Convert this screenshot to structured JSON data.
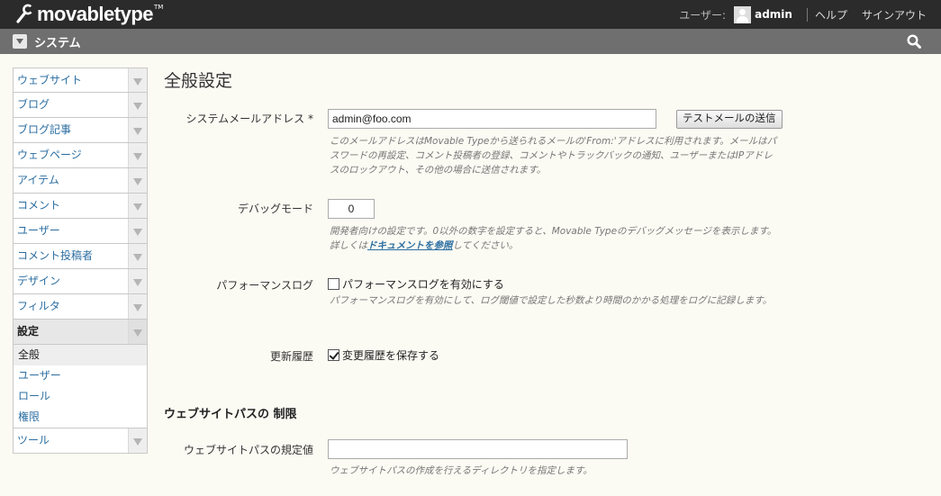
{
  "header": {
    "logo_text": "movabletype",
    "logo_tm": "TM",
    "user_label": "ユーザー:",
    "username": "admin",
    "help": "ヘルプ",
    "signout": "サインアウト"
  },
  "sysbar": {
    "title": "システム"
  },
  "sidebar": {
    "items": [
      {
        "label": "ウェブサイト"
      },
      {
        "label": "ブログ"
      },
      {
        "label": "ブログ記事"
      },
      {
        "label": "ウェブページ"
      },
      {
        "label": "アイテム"
      },
      {
        "label": "コメント"
      },
      {
        "label": "ユーザー"
      },
      {
        "label": "コメント投稿者"
      },
      {
        "label": "デザイン"
      },
      {
        "label": "フィルタ"
      },
      {
        "label": "設定"
      }
    ],
    "submenu": [
      {
        "label": "全般"
      },
      {
        "label": "ユーザー"
      },
      {
        "label": "ロール"
      },
      {
        "label": "権限"
      }
    ],
    "last_item": {
      "label": "ツール"
    }
  },
  "main": {
    "title": "全般設定",
    "email": {
      "label": "システムメールアドレス *",
      "value": "admin@foo.com",
      "button": "テストメールの送信",
      "hint": "このメールアドレスはMovable Typeから送られるメールの'From:'アドレスに利用されます。メールはパスワードの再設定、コメント投稿者の登録、コメントやトラックバックの通知、ユーザーまたはIPアドレスのロックアウト、その他の場合に送信されます。"
    },
    "debug": {
      "label": "デバッグモード",
      "value": "0",
      "hint_before": "開発者向けの設定です。0以外の数字を設定すると、Movable Typeのデバッグメッセージを表示します。詳しくは",
      "hint_link": "ドキュメントを参照",
      "hint_after": "してください。"
    },
    "perflog": {
      "label": "パフォーマンスログ",
      "checkbox_label": "パフォーマンスログを有効にする",
      "checked": false,
      "hint": "パフォーマンスログを有効にして、ログ閾値で設定した秒数より時間のかかる処理をログに記録します。"
    },
    "history": {
      "label": "更新履歴",
      "checkbox_label": "変更履歴を保存する",
      "checked": true
    },
    "section_title": "ウェブサイトパスの 制限",
    "website_path": {
      "label": "ウェブサイトパスの規定値",
      "value": "",
      "hint": "ウェブサイトパスの作成を行えるディレクトリを指定します。"
    }
  }
}
